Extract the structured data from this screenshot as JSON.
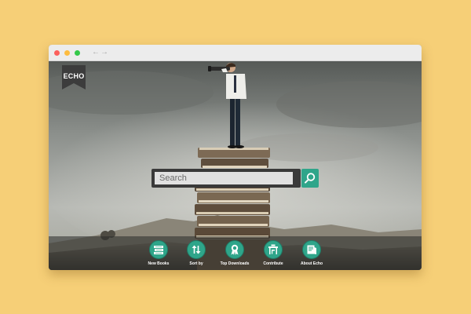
{
  "browser": {
    "back_arrow": "←",
    "forward_arrow": "→"
  },
  "logo": {
    "text": "ECHO"
  },
  "search": {
    "placeholder": "Search",
    "button_icon": "search-icon"
  },
  "nav": {
    "items": [
      {
        "label": "New Books",
        "icon": "books-icon"
      },
      {
        "label": "Sort by",
        "icon": "sort-arrows-icon"
      },
      {
        "label": "Top Downloads",
        "icon": "award-ribbon-icon"
      },
      {
        "label": "Contribute",
        "icon": "desk-chair-icon"
      },
      {
        "label": "About Echo",
        "icon": "book-info-icon"
      }
    ]
  },
  "colors": {
    "page_background": "#f6cf77",
    "accent": "#2fa58a",
    "logo_ribbon": "#3c3c3c"
  }
}
